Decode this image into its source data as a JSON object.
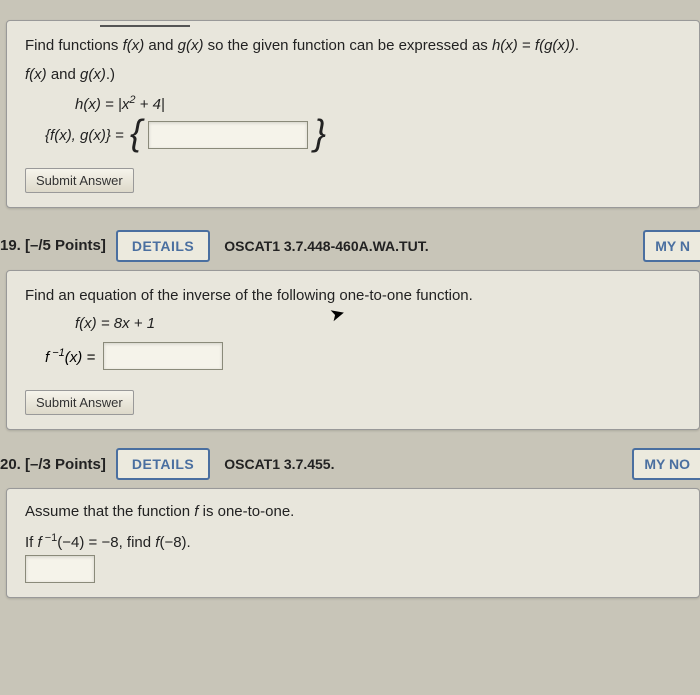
{
  "q18": {
    "prompt_a": "Find functions ",
    "fx": "f(x)",
    "and": " and ",
    "gx": "g(x)",
    "prompt_b": " so the given function can be expressed as ",
    "hx": "h(x)",
    "eq": " = ",
    "fgx": "f(g(x))",
    "dot": ".",
    "line2a": "f(x)",
    "line2b": " and ",
    "line2c": "g(x)",
    "line2d": ".)",
    "formula": "h(x) = |x² + 4|",
    "pair_lhs": "{f(x), g(x)} = ",
    "submit": "Submit Answer"
  },
  "q19": {
    "number": "19.",
    "points": "[–/5 Points]",
    "details": "DETAILS",
    "ref": "OSCAT1 3.7.448-460A.WA.TUT.",
    "mynotes": "MY N",
    "prompt": "Find an equation of the inverse of the following one-to-one function.",
    "formula": "f(x) = 8x + 1",
    "inv_lhs": "f⁻¹(x) = ",
    "submit": "Submit Answer"
  },
  "q20": {
    "number": "20.",
    "points": "[–/3 Points]",
    "details": "DETAILS",
    "ref": "OSCAT1 3.7.455.",
    "mynotes": "MY NO",
    "prompt": "Assume that the function f is one-to-one.",
    "find": "If f⁻¹(−4) = −8, find f(−8)."
  }
}
